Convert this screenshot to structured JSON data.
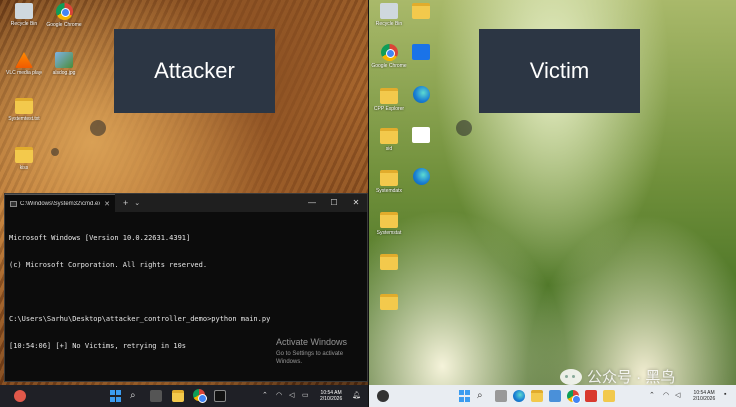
{
  "left_panel": {
    "label": "Attacker",
    "desktop_icons": [
      {
        "name": "Recycle Bin",
        "icon": "recycle-bin-icon"
      },
      {
        "name": "Google Chrome",
        "icon": "chrome-icon"
      },
      {
        "name": "VLC media player.lnk",
        "icon": "vlc-icon"
      },
      {
        "name": "alsdog.jpg",
        "icon": "image-icon"
      },
      {
        "name": "Systemtest.txt",
        "icon": "folder-icon"
      },
      {
        "name": "kiss",
        "icon": "folder-icon"
      }
    ],
    "terminal": {
      "tab_title": "C:\\Windows\\System32\\cmd.exe",
      "lines": [
        "Microsoft Windows [Version 10.0.22631.4391]",
        "(c) Microsoft Corporation. All rights reserved.",
        "",
        "C:\\Users\\Sarhu\\Desktop\\attacker_controller_demo>python main.py",
        "[10:54:06] [+] No Victims, retrying in 10s"
      ]
    },
    "activate_windows": {
      "title": "Activate Windows",
      "subtitle": "Go to Settings to activate Windows."
    },
    "taskbar": {
      "time": "10:54 AM",
      "date": "2/10/2026"
    }
  },
  "right_panel": {
    "label": "Victim",
    "desktop_icons": [
      {
        "name": "Recycle Bin",
        "icon": "recycle-bin-icon"
      },
      {
        "name": "Google Chrome",
        "icon": "chrome-icon"
      },
      {
        "name": "CPP Explorer",
        "icon": "folder-icon"
      },
      {
        "name": "sid",
        "icon": "folder-icon"
      },
      {
        "name": "Systemdatx",
        "icon": "folder-icon"
      },
      {
        "name": "Systemstat",
        "icon": "folder-icon"
      }
    ],
    "taskbar": {
      "time": "10:54 AM",
      "date": "2/10/2026"
    }
  },
  "watermark": "公众号 · 黑鸟",
  "colors": {
    "label_bg": "#2c3644",
    "terminal_bg": "#0c0c0c"
  }
}
